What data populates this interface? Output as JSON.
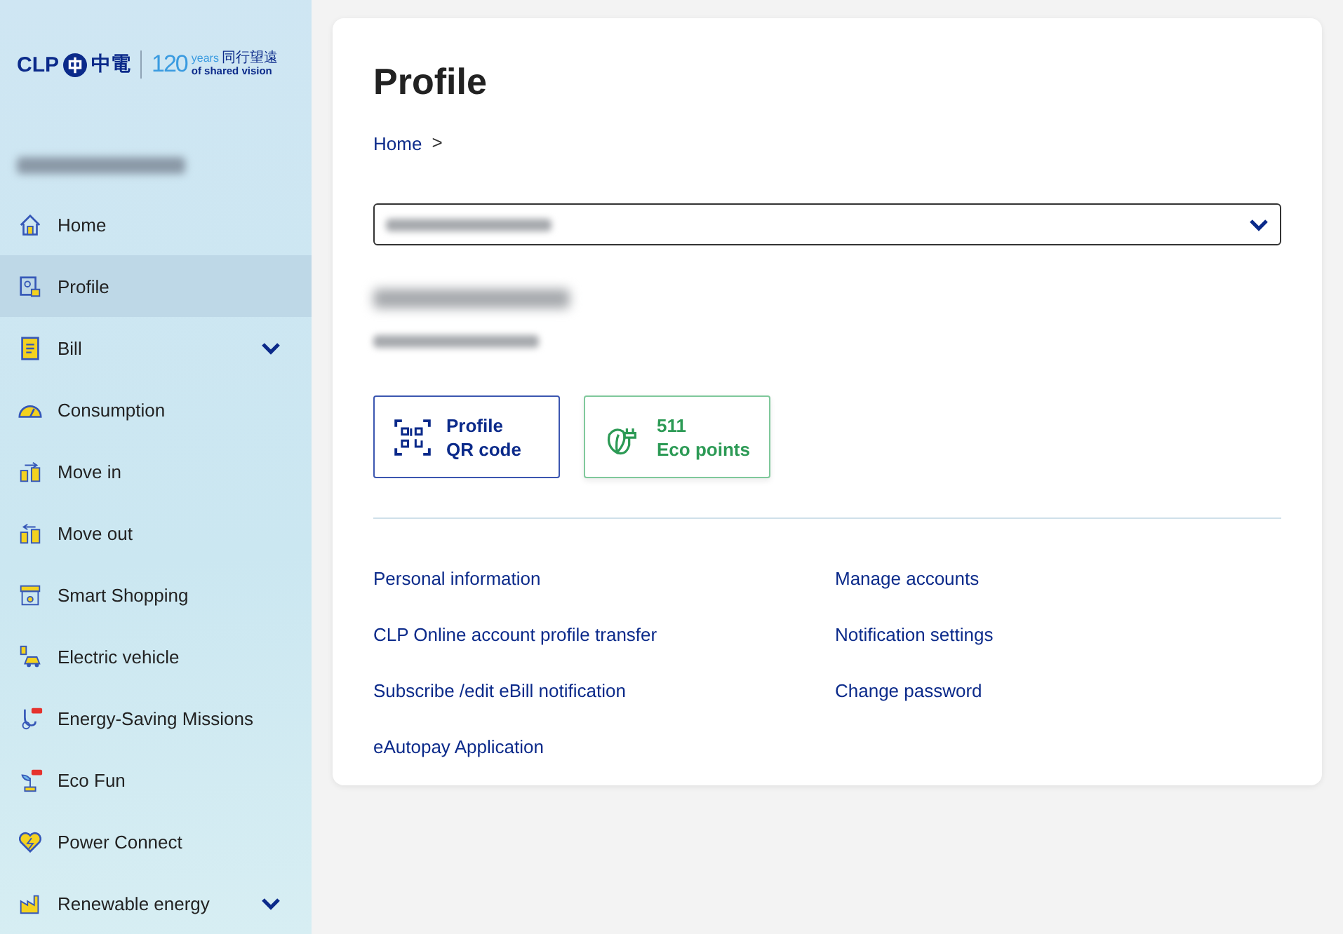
{
  "logo": {
    "brand": "CLP",
    "brand_chinese": "中電",
    "anniversary": "120",
    "years": "years",
    "slogan_chinese": "同行望遠",
    "slogan": "of shared vision"
  },
  "sidebar": {
    "items": [
      {
        "label": "Home",
        "selected": false,
        "expandable": false
      },
      {
        "label": "Profile",
        "selected": true,
        "expandable": false
      },
      {
        "label": "Bill",
        "selected": false,
        "expandable": true
      },
      {
        "label": "Consumption",
        "selected": false,
        "expandable": false
      },
      {
        "label": "Move in",
        "selected": false,
        "expandable": false
      },
      {
        "label": "Move out",
        "selected": false,
        "expandable": false
      },
      {
        "label": "Smart Shopping",
        "selected": false,
        "expandable": false
      },
      {
        "label": "Electric vehicle",
        "selected": false,
        "expandable": false
      },
      {
        "label": "Energy-Saving Missions",
        "selected": false,
        "expandable": false
      },
      {
        "label": "Eco Fun",
        "selected": false,
        "expandable": false
      },
      {
        "label": "Power Connect",
        "selected": false,
        "expandable": false
      },
      {
        "label": "Renewable energy",
        "selected": false,
        "expandable": true
      }
    ]
  },
  "page": {
    "title": "Profile",
    "breadcrumb": [
      {
        "label": "Home"
      },
      {
        "label": ">"
      }
    ],
    "actions": [
      {
        "kind": "qr",
        "line_1": "Profile",
        "line_2": "QR code"
      },
      {
        "kind": "eco",
        "line_1": "511",
        "line_2": "Eco points"
      }
    ],
    "links": [
      {
        "label": "Personal information"
      },
      {
        "label": "Manage accounts"
      },
      {
        "label": "CLP Online account profile transfer"
      },
      {
        "label": "Notification settings"
      },
      {
        "label": "Subscribe /edit eBill notification"
      },
      {
        "label": "Change password"
      },
      {
        "label": "eAutopay Application"
      }
    ]
  }
}
